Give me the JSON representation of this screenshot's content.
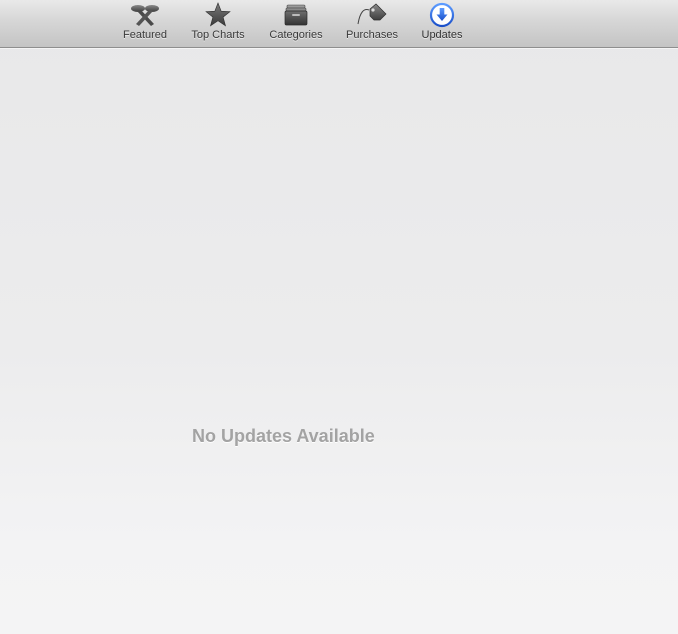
{
  "toolbar": {
    "tabs": [
      {
        "id": "featured",
        "label": "Featured",
        "icon": "featured-icon"
      },
      {
        "id": "top-charts",
        "label": "Top Charts",
        "icon": "star-icon"
      },
      {
        "id": "categories",
        "label": "Categories",
        "icon": "categories-icon"
      },
      {
        "id": "purchases",
        "label": "Purchases",
        "icon": "price-tag-icon"
      },
      {
        "id": "updates",
        "label": "Updates",
        "icon": "download-arrow-icon",
        "active": true
      }
    ],
    "accent": "#1a5ee0"
  },
  "content": {
    "message": "No Updates Available"
  }
}
